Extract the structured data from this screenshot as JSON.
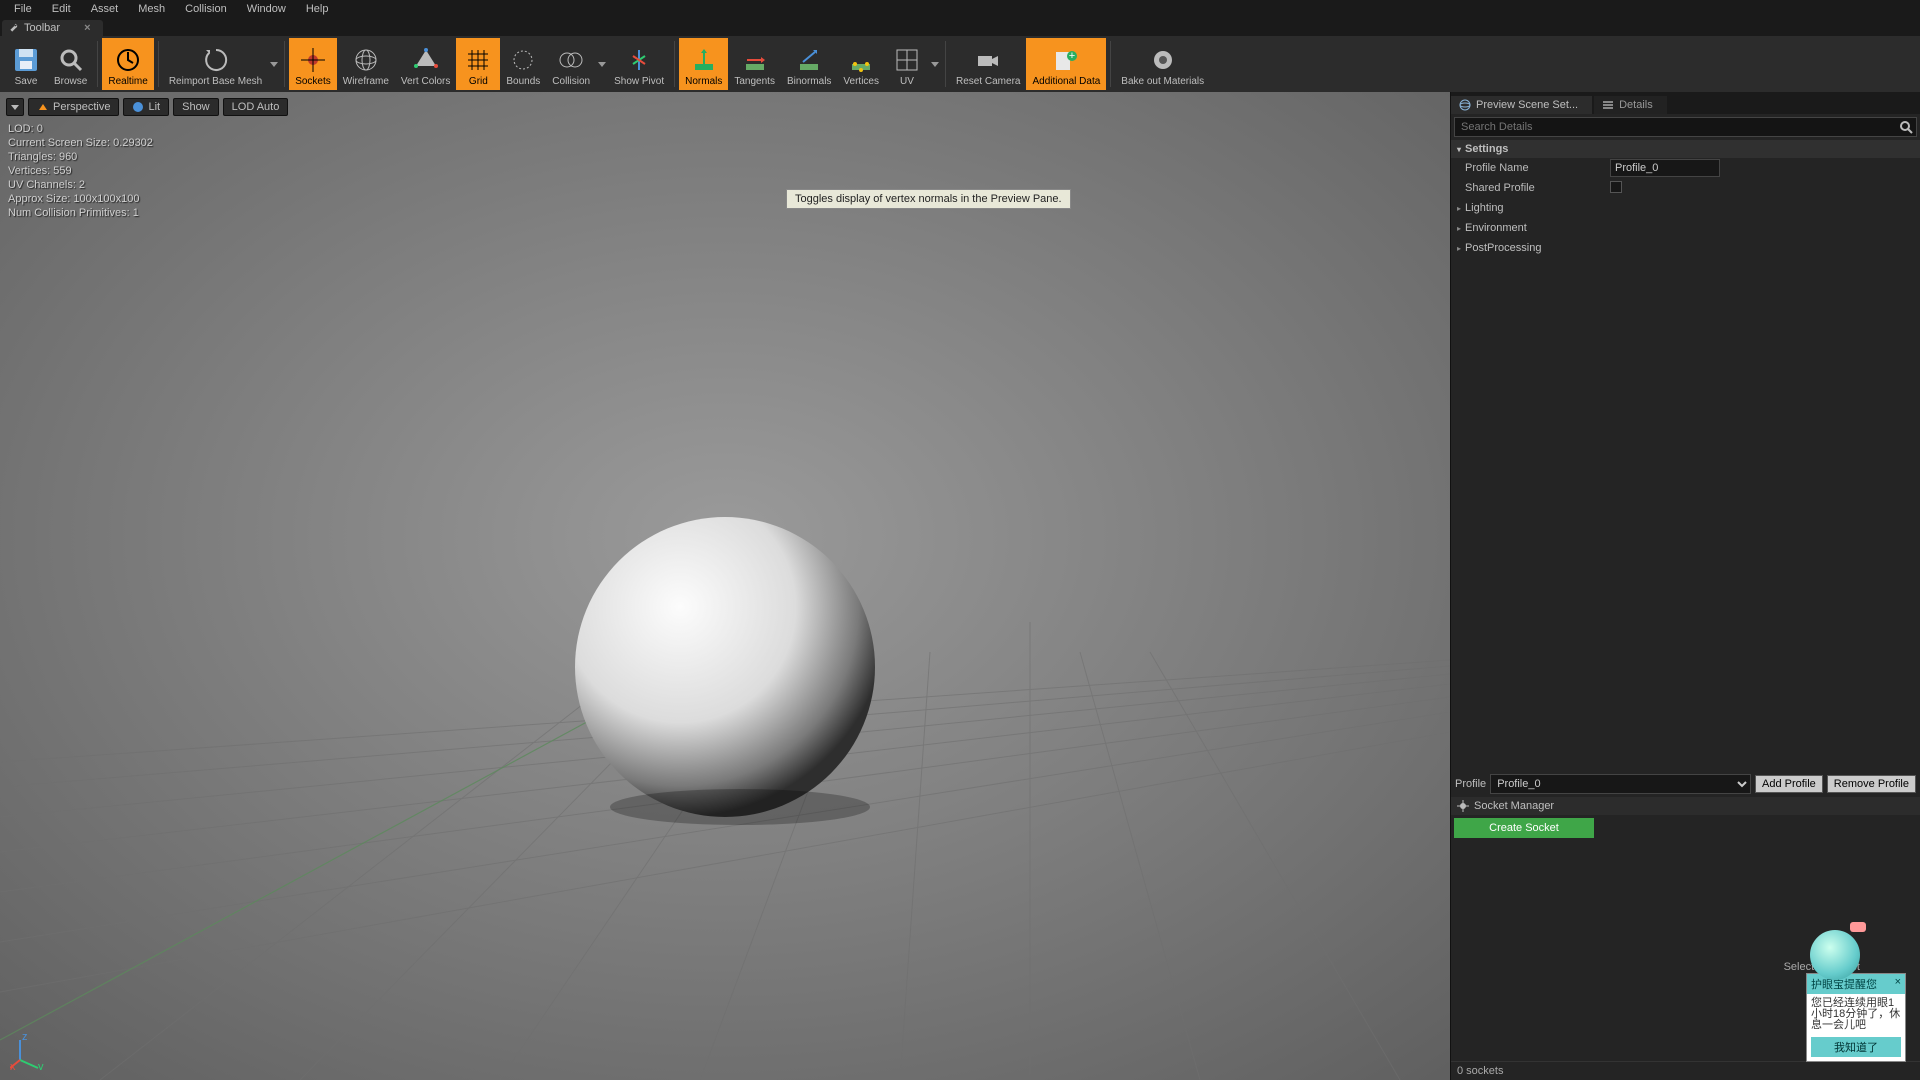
{
  "menu": {
    "items": [
      "File",
      "Edit",
      "Asset",
      "Mesh",
      "Collision",
      "Window",
      "Help"
    ]
  },
  "toolbar_tab": {
    "label": "Toolbar"
  },
  "toolbar": {
    "save": "Save",
    "browse": "Browse",
    "realtime": "Realtime",
    "reimport": "Reimport Base Mesh",
    "sockets": "Sockets",
    "wireframe": "Wireframe",
    "vertcolors": "Vert Colors",
    "grid": "Grid",
    "bounds": "Bounds",
    "collision": "Collision",
    "showpivot": "Show Pivot",
    "normals": "Normals",
    "tangents": "Tangents",
    "binormals": "Binormals",
    "vertices": "Vertices",
    "uv": "UV",
    "resetcamera": "Reset Camera",
    "additionaldata": "Additional Data",
    "bakeout": "Bake out Materials"
  },
  "tooltip": "Toggles display of vertex normals in the Preview Pane.",
  "viewport": {
    "btn_perspective": "Perspective",
    "btn_lit": "Lit",
    "btn_show": "Show",
    "btn_lodauto": "LOD Auto",
    "stats": {
      "lod": "LOD:  0",
      "screen": "Current Screen Size: 0.29302",
      "tris": "Triangles:  960",
      "verts": "Vertices:  559",
      "uvch": "UV Channels:  2",
      "approx": "Approx Size: 100x100x100",
      "collprim": "Num Collision Primitives:  1"
    }
  },
  "rp": {
    "tab_preview": "Preview Scene Set...",
    "tab_details": "Details",
    "search_placeholder": "Search Details",
    "settings_hdr": "Settings",
    "profile_name_label": "Profile Name",
    "profile_name_value": "Profile_0",
    "shared_profile_label": "Shared Profile",
    "lighting": "Lighting",
    "environment": "Environment",
    "postprocessing": "PostProcessing",
    "profile_label": "Profile",
    "profile_value": "Profile_0",
    "add_profile": "Add Profile",
    "remove_profile": "Remove Profile",
    "socket_manager": "Socket Manager",
    "create_socket": "Create Socket",
    "select_socket": "Select a Socket",
    "socket_count": "0 sockets"
  },
  "popup": {
    "title": "护眼宝提醒您",
    "body": "您已经连续用眼1小时18分钟了，休息一会儿吧",
    "btn": "我知道了"
  }
}
